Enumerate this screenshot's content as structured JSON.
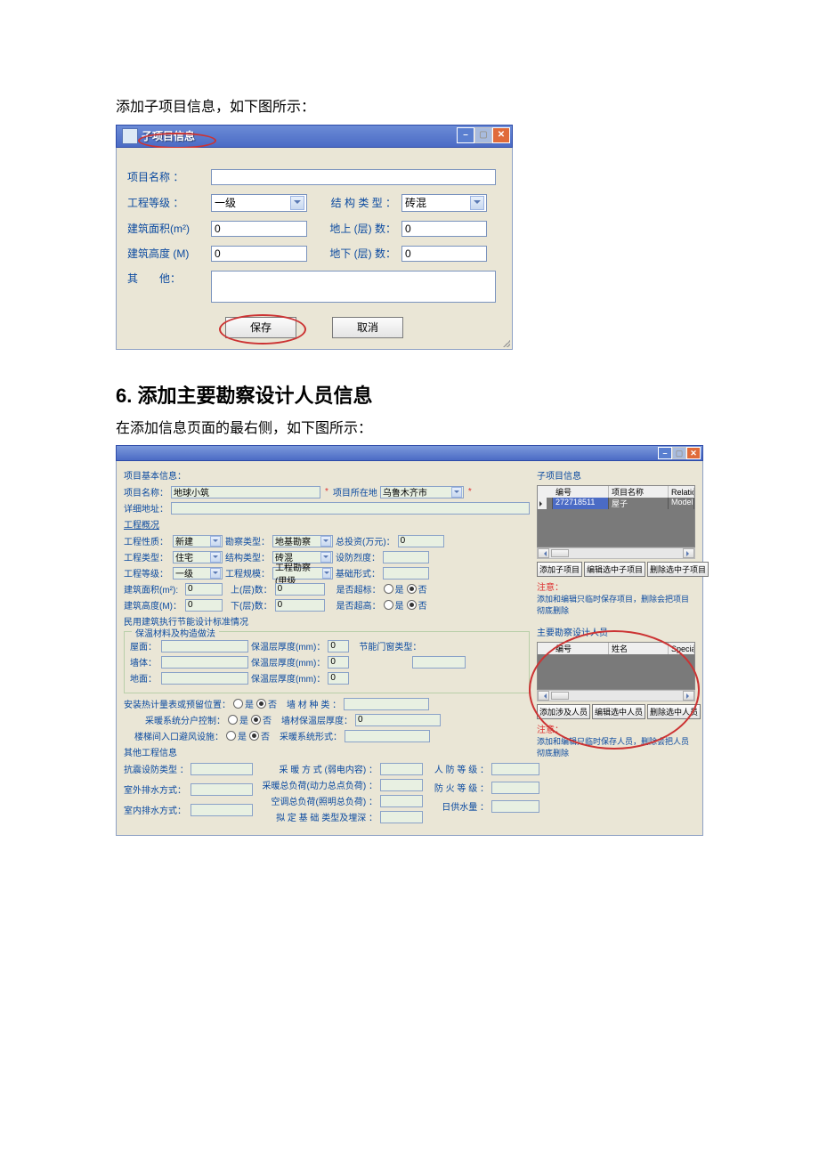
{
  "doc": {
    "intro1": "添加子项目信息，如下图所示：",
    "section_heading": "6. 添加主要勘察设计人员信息",
    "intro2": "在添加信息页面的最右侧，如下图所示："
  },
  "dlg1": {
    "title": "子项目信息",
    "labels": {
      "project_name": "项目名称 ：",
      "grade": "工程等级 ：",
      "struct_type": "结 构 类 型 ：",
      "area": "建筑面积(m²)",
      "above": "地上 (层) 数：",
      "height": "建筑高度 (M)",
      "below": "地下 (层) 数：",
      "other": "其　　他："
    },
    "values": {
      "grade": "一级",
      "struct_type": "砖混",
      "area": "0",
      "above": "0",
      "height": "0",
      "below": "0"
    },
    "buttons": {
      "save": "保存",
      "cancel": "取消"
    }
  },
  "dlg2": {
    "sections": {
      "basic": "项目基本信息：",
      "overview_link": "工程概况",
      "energy": "民用建筑执行节能设计标准情况",
      "insulation_fs": "保温材料及构造做法",
      "other_eng": "其他工程信息",
      "sub_hdr": "子项目信息",
      "designers_hdr": "主要勘察设计人员"
    },
    "labels": {
      "project_name": "项目名称：",
      "project_location": "项目所在地",
      "detail_addr": "详细地址：",
      "eng_nature": "工程性质：",
      "survey_type": "勘察类型：",
      "total_invest": "总投资(万元)：",
      "eng_type": "工程类型：",
      "struct_type": "结构类型：",
      "seismic_intensity": "设防烈度：",
      "eng_grade": "工程等级：",
      "eng_scale": "工程规模：",
      "foundation": "基础形式：",
      "area": "建筑面积(m²):",
      "above": "上(层)数：",
      "over_std": "是否超标：",
      "height": "建筑高度(M)：",
      "below": "下(层)数：",
      "over_height": "是否超高：",
      "yes": "是",
      "no": "否",
      "roof": "屋面：",
      "wall": "墙体：",
      "floor": "地面：",
      "ins_thk": "保温层厚度(mm)：",
      "es_door": "节能门窗类型：",
      "meter_pos": "安装热计量表或预留位置：",
      "wall_kind": "墙 材 种 类 ：",
      "heating_split": "采暖系统分户控制：",
      "wall_ins_thk": "墙材保温层厚度：",
      "stair_shelter": "楼梯间入口避风设施：",
      "heating_form": "采暖系统形式：",
      "seismic_type": "抗震设防类型 ：",
      "heating_mode": "采 暖 方 式 (弱电内容) ：",
      "outdoor_drain": "室外排水方式：",
      "heating_load": "采暖总负荷(动力总点负荷) ：",
      "ac_load": "空调总负荷(照明总负荷) ：",
      "indoor_drain": "室内排水方式：",
      "foundation_depth": "拟 定 基 础 类型及埋深 ：",
      "civil_defense": "人 防 等 级 ：",
      "fire_grade": "防 火 等 级 ：",
      "daily_water": "日供水量 ："
    },
    "values": {
      "project_name": "地球小筑",
      "location": "乌鲁木齐市",
      "eng_nature": "新建",
      "survey_type": "地基勘察",
      "total_invest": "0",
      "eng_type": "住宅",
      "struct_type": "砖混",
      "eng_grade": "一级",
      "eng_scale": "工程勘察(甲级",
      "area": "0",
      "above": "0",
      "height": "0",
      "below": "0",
      "ins_thk": "0",
      "wall_ins_thk": "0"
    },
    "grid_sub": {
      "cols": {
        "blank": "",
        "id": "编号",
        "name": "项目名称",
        "rel": "Relatio"
      },
      "row": {
        "id": "272718511",
        "name": "屋子",
        "rel": "Model.D"
      }
    },
    "grid_des": {
      "cols": {
        "blank": "",
        "id": "编号",
        "name": "姓名",
        "spec": "Special"
      }
    },
    "sub_btns": {
      "add": "添加子项目",
      "edit": "编辑选中子项目",
      "del": "删除选中子项目"
    },
    "des_btns": {
      "add": "添加涉及人员",
      "edit": "编辑选中人员",
      "del": "删除选中人员"
    },
    "notes": {
      "t": "注意：",
      "sub": "添加和编辑只临时保存项目，删除会把项目彻底删除",
      "des": "添加和编辑只临时保存人员，删除会把人员彻底删除"
    }
  }
}
